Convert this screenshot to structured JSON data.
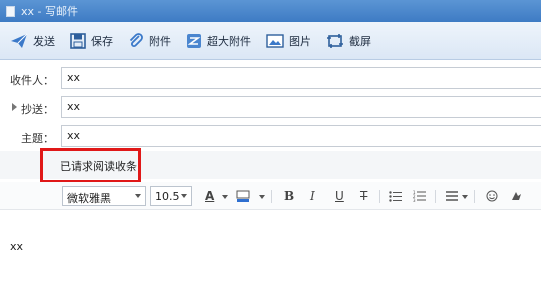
{
  "window": {
    "title": "xx - 写邮件"
  },
  "toolbar": {
    "send": "发送",
    "save": "保存",
    "attach": "附件",
    "bigattach": "超大附件",
    "image": "图片",
    "screenshot": "截屏"
  },
  "fields": {
    "to_label": "收件人：",
    "to_value": "xx",
    "cc_label": "抄送：",
    "cc_value": "xx",
    "subject_label": "主题：",
    "subject_value": "xx"
  },
  "receipt": {
    "text": "已请求阅读收条",
    "highlight_color": "#e01818"
  },
  "format": {
    "font_family": "微软雅黑",
    "font_size": "10.5",
    "icons": [
      "font-color-icon",
      "highlight-color-icon",
      "bold-icon",
      "italic-icon",
      "underline-icon",
      "strikethrough-icon",
      "bullet-list-icon",
      "numbered-list-icon",
      "align-icon",
      "emoji-icon",
      "more-icon"
    ],
    "bold": "B",
    "italic": "I",
    "underline": "U",
    "strike": "T",
    "font_color": "A"
  },
  "body": {
    "text": "xx"
  }
}
